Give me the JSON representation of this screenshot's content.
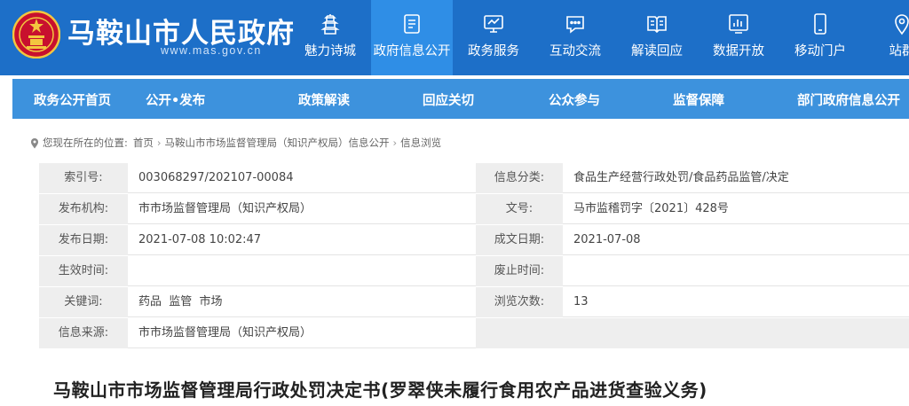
{
  "header": {
    "site_title": "马鞍山市人民政府",
    "site_url": "www.mas.gov.cn",
    "nav": [
      {
        "label": "魅力诗城",
        "icon": "pagoda-icon"
      },
      {
        "label": "政府信息公开",
        "icon": "document-icon"
      },
      {
        "label": "政务服务",
        "icon": "monitor-icon"
      },
      {
        "label": "互动交流",
        "icon": "chat-icon"
      },
      {
        "label": "解读回应",
        "icon": "open-book-icon"
      },
      {
        "label": "数据开放",
        "icon": "bar-chart-icon"
      },
      {
        "label": "移动门户",
        "icon": "mobile-icon"
      },
      {
        "label": "站群",
        "icon": "location-pin-icon"
      }
    ]
  },
  "sub_nav": [
    "政务公开首页",
    "公开•发布",
    "政策解读",
    "回应关切",
    "公众参与",
    "监督保障",
    "部门政府信息公开"
  ],
  "breadcrumb": {
    "prefix": "您现在所在的位置:",
    "items": [
      "首页",
      "马鞍山市市场监督管理局（知识产权局）信息公开",
      "信息浏览"
    ]
  },
  "info": {
    "index_label": "索引号:",
    "index_value": "003068297/202107-00084",
    "category_label": "信息分类:",
    "category_value": "食品生产经营行政处罚/食品药品监管/决定",
    "publisher_label": "发布机构:",
    "publisher_value": "市市场监督管理局（知识产权局）",
    "docno_label": "文号:",
    "docno_value": "马市监稽罚字〔2021〕428号",
    "pubdate_label": "发布日期:",
    "pubdate_value": "2021-07-08 10:02:47",
    "writedate_label": "成文日期:",
    "writedate_value": "2021-07-08",
    "effective_label": "生效时间:",
    "effective_value": "",
    "expire_label": "废止时间:",
    "expire_value": "",
    "keywords_label": "关键词:",
    "keywords_value": "药品  监管  市场",
    "views_label": "浏览次数:",
    "views_value": "13",
    "source_label": "信息来源:",
    "source_value": "市市场监督管理局（知识产权局）"
  },
  "doc_title": "马鞍山市市场监督管理局行政处罚决定书(罗翠侠未履行食用农产品进货查验义务)",
  "colors": {
    "header_bg": "#1d6fc8",
    "active_nav_bg": "#2f8ee6",
    "sub_nav_bg": "#3d92dd",
    "label_bg": "#eeeeee"
  }
}
